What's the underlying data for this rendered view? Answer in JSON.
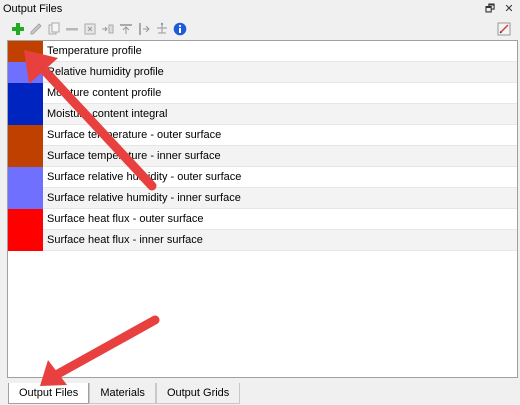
{
  "panel": {
    "title": "Output Files",
    "float_glyph": "🗗",
    "close_glyph": "✕"
  },
  "toolbar": {
    "icons": [
      "add-icon",
      "edit-icon",
      "copy-icon",
      "remove-icon",
      "clear-icon",
      "move-in-icon",
      "move-up-icon",
      "move-down-icon",
      "balance-icon",
      "info-icon"
    ],
    "right_icon": "grid-edit-icon"
  },
  "output_files": [
    {
      "label": "Temperature profile",
      "color": "#c04000"
    },
    {
      "label": "Relative humidity profile",
      "color": "#7070ff"
    },
    {
      "label": "Moisture content profile",
      "color": "#0024c0"
    },
    {
      "label": "Moisture content integral",
      "color": "#0024c0"
    },
    {
      "label": "Surface temperature - outer surface",
      "color": "#c04000"
    },
    {
      "label": "Surface temperature - inner surface",
      "color": "#c04000"
    },
    {
      "label": "Surface relative humidity - outer surface",
      "color": "#7070ff"
    },
    {
      "label": "Surface relative humidity - inner surface",
      "color": "#7070ff"
    },
    {
      "label": "Surface heat flux - outer surface",
      "color": "#ff0000"
    },
    {
      "label": "Surface heat flux - inner surface",
      "color": "#ff0000"
    }
  ],
  "tabs": [
    {
      "label": "Output Files",
      "active": true
    },
    {
      "label": "Materials",
      "active": false
    },
    {
      "label": "Output Grids",
      "active": false
    }
  ],
  "colors": {
    "annotation_arrow": "#e8403e",
    "accent_add": "#22aa22"
  }
}
